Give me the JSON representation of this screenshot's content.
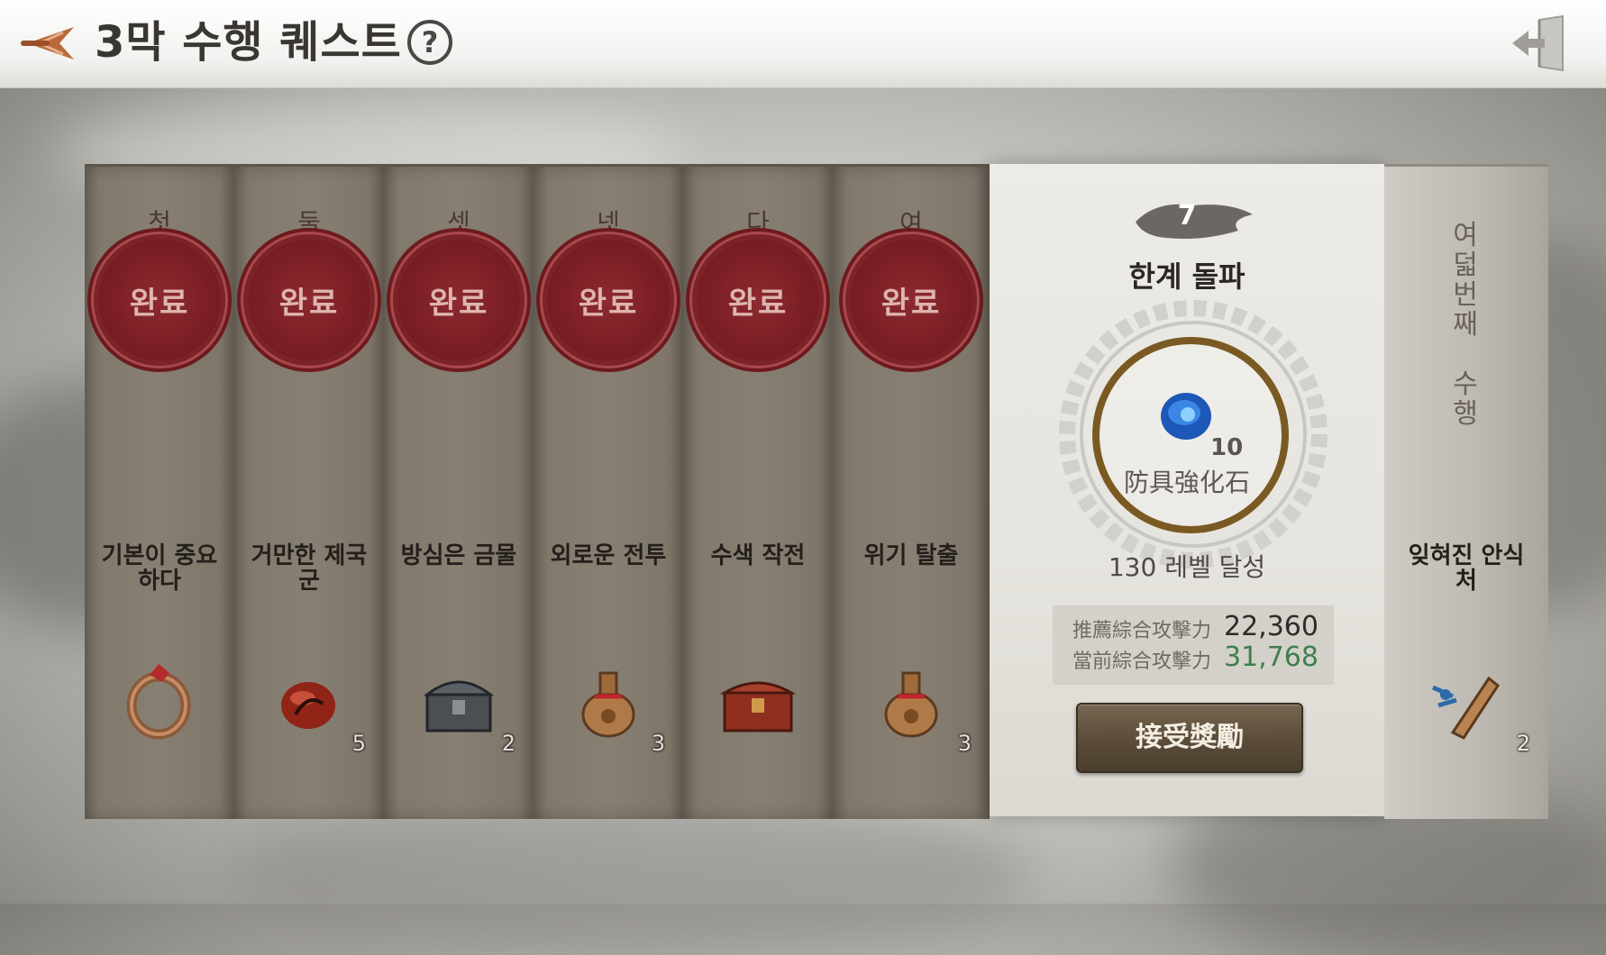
{
  "header": {
    "title": "3막 수행 퀘스트",
    "help": "?"
  },
  "completed_quests": [
    {
      "ordinal": "첫\n\n\n\n행",
      "stamp": "완료",
      "name": "기본이 중요\n하다",
      "reward_icon": "ring-icon",
      "reward_count": ""
    },
    {
      "ordinal": "둘\n\n\n\n행",
      "stamp": "완료",
      "name": "거만한 제국\n군",
      "reward_icon": "red-gem-icon",
      "reward_count": "5"
    },
    {
      "ordinal": "셋\n\n\n\n행",
      "stamp": "완료",
      "name": "방심은 금물",
      "reward_icon": "iron-chest-icon",
      "reward_count": "2"
    },
    {
      "ordinal": "넷\n\n\n\n행",
      "stamp": "완료",
      "name": "외로운 전투",
      "reward_icon": "potion-bottle-icon",
      "reward_count": "3"
    },
    {
      "ordinal": "다\n\n\n\n행",
      "stamp": "완료",
      "name": "수색 작전",
      "reward_icon": "red-chest-icon",
      "reward_count": ""
    },
    {
      "ordinal": "여\n\n\n\n행",
      "stamp": "완료",
      "name": "위기 탈출",
      "reward_icon": "potion-bottle-icon",
      "reward_count": "3"
    }
  ],
  "active_quest": {
    "number": "7",
    "name": "한계 돌파",
    "reward_icon": "blue-stone-icon",
    "reward_qty": "10",
    "reward_name": "防具強化石",
    "condition": "130 레벨 달성",
    "recommended_label": "推薦綜合攻擊力",
    "recommended_value": "22,360",
    "current_label": "當前綜合攻擊力",
    "current_value": "31,768",
    "accept_label": "接受獎勵"
  },
  "locked_quest": {
    "vertical_title": "여\n덟\n번\n째\n\n수\n행",
    "name": "잊혀진 안식\n처",
    "reward_icon": "wooden-charm-icon",
    "reward_count": "2"
  },
  "colors": {
    "stamp_red": "#7a1e24",
    "current_value_green": "#3f7f4d",
    "ring_bronze": "#7a5a22"
  }
}
